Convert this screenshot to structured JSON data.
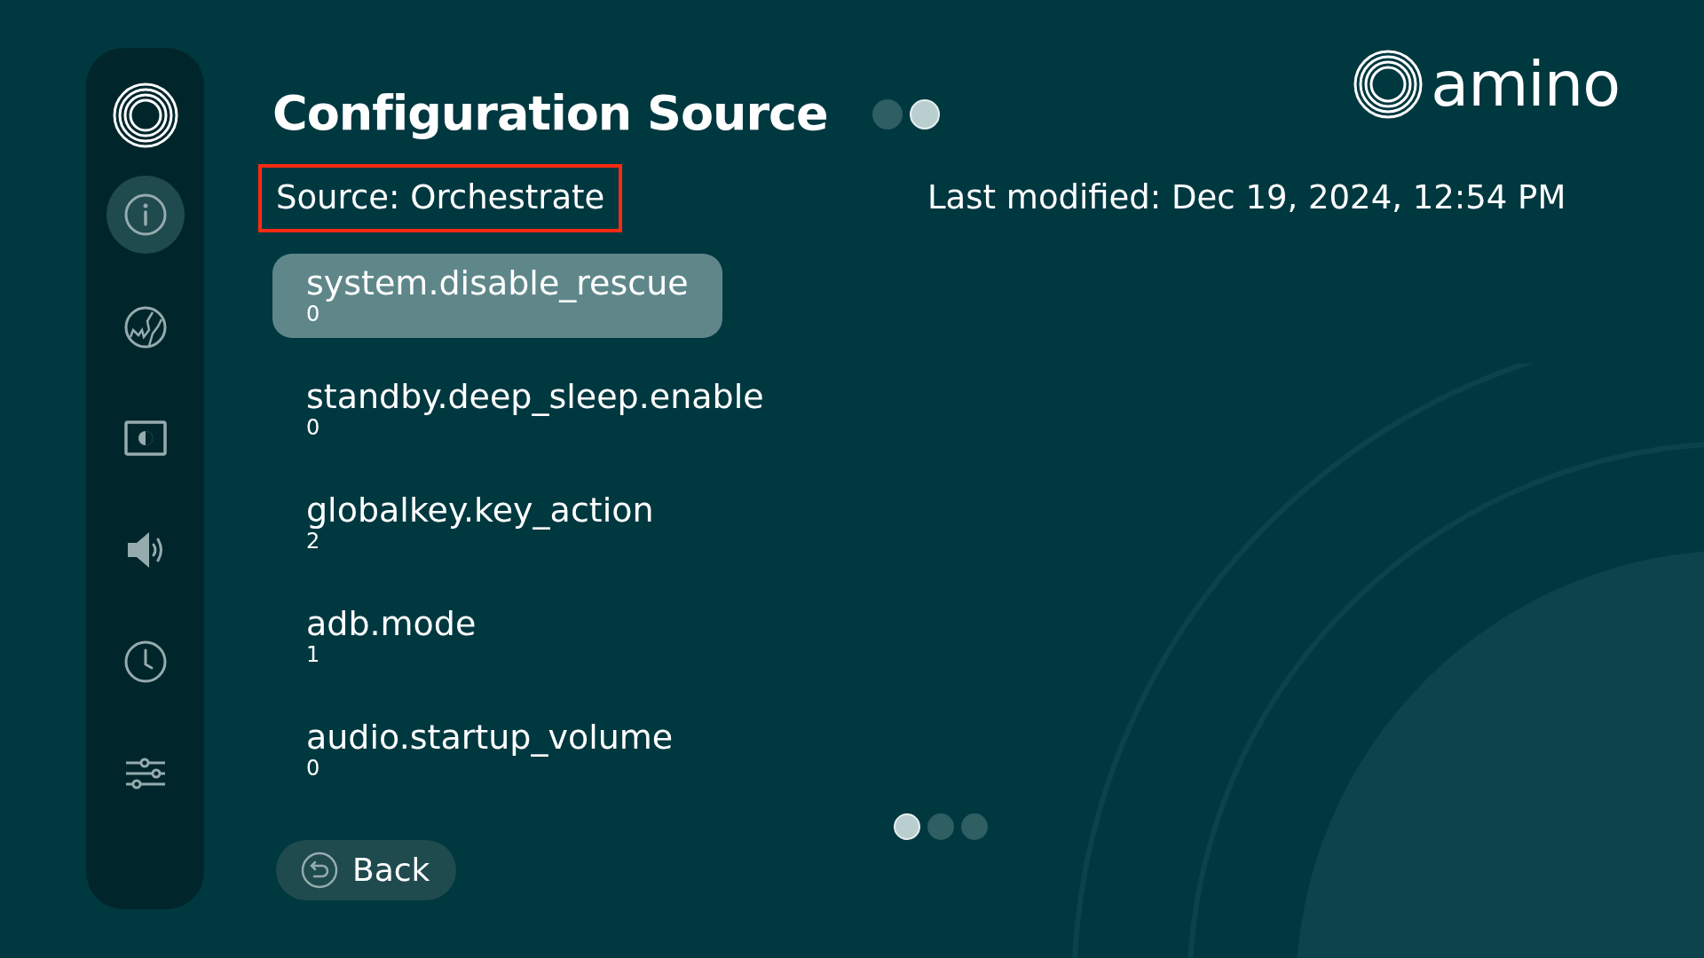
{
  "sidebar": {
    "items": [
      {
        "selected": true
      },
      {
        "selected": false
      },
      {
        "selected": false
      },
      {
        "selected": false
      },
      {
        "selected": false
      },
      {
        "selected": false
      }
    ]
  },
  "header": {
    "title": "Configuration Source",
    "step_dots": [
      {
        "selected": false
      },
      {
        "selected": true
      }
    ],
    "logo_text": "amino"
  },
  "source": {
    "label": "Source: Orchestrate",
    "highlighted": true
  },
  "last_modified": "Last modified: Dec 19, 2024, 12:54 PM",
  "settings": [
    {
      "name": "system.disable_rescue",
      "value": "0",
      "selected": true
    },
    {
      "name": "standby.deep_sleep.enable",
      "value": "0",
      "selected": false
    },
    {
      "name": "globalkey.key_action",
      "value": "2",
      "selected": false
    },
    {
      "name": "adb.mode",
      "value": "1",
      "selected": false
    },
    {
      "name": "audio.startup_volume",
      "value": "0",
      "selected": false
    }
  ],
  "page_dots": [
    {
      "selected": true
    },
    {
      "selected": false
    },
    {
      "selected": false
    }
  ],
  "back_button": {
    "label": "Back"
  }
}
